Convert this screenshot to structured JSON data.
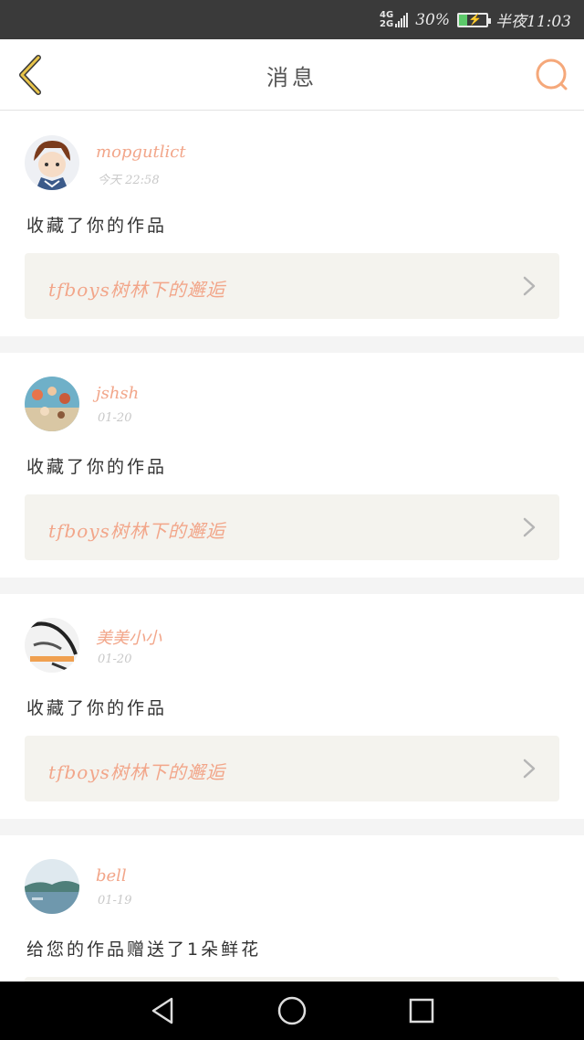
{
  "status_bar": {
    "network_top": "4G",
    "network_bottom": "2G",
    "battery_percent": "30%",
    "battery_level": 0.3,
    "time": "半夜11:03"
  },
  "header": {
    "title": "消息",
    "back_icon": "chevron-left-icon",
    "search_icon": "search-icon"
  },
  "colors": {
    "accent": "#f2a68a",
    "back_icon": "#e8c44a",
    "search_icon": "#f5a87a",
    "link_bg": "#f4f3ee"
  },
  "messages": [
    {
      "username": "mopgutlict",
      "time": "今天 22:58",
      "action": "收藏了你的作品",
      "work_title": "tfboys树林下的邂逅",
      "avatar": "avatar-cartoon-boy"
    },
    {
      "username": "jshsh",
      "time": "01-20",
      "action": "收藏了你的作品",
      "work_title": "tfboys树林下的邂逅",
      "avatar": "avatar-beach-shells"
    },
    {
      "username": "美美小小",
      "time": "01-20",
      "action": "收藏了你的作品",
      "work_title": "tfboys树林下的邂逅",
      "avatar": "avatar-sketch"
    },
    {
      "username": "bell",
      "time": "01-19",
      "action": "给您的作品赠送了1朵鲜花",
      "work_title": "",
      "avatar": "avatar-lake"
    }
  ],
  "nav_bar": {
    "back": "triangle-back-icon",
    "home": "circle-home-icon",
    "recents": "square-recents-icon"
  }
}
